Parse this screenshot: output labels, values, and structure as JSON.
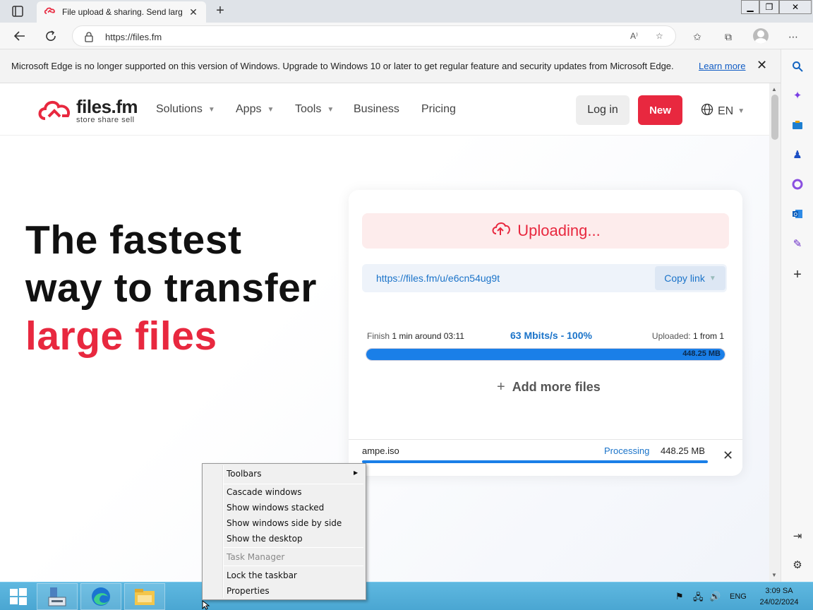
{
  "browser": {
    "tab_title": "File upload & sharing. Send large files",
    "url": "https://files.fm",
    "infobar": {
      "message": "Microsoft Edge is no longer supported on this version of Windows. Upgrade to Windows 10 or later to get regular feature and security updates from Microsoft Edge.",
      "link": "Learn more"
    }
  },
  "site": {
    "logo_name": "files.fm",
    "logo_tagline": "store share sell",
    "nav": [
      {
        "label": "Solutions"
      },
      {
        "label": "Apps"
      },
      {
        "label": "Tools"
      },
      {
        "label": "Business"
      },
      {
        "label": "Pricing"
      }
    ],
    "login_label": "Log in",
    "new_label": "New",
    "language": "EN"
  },
  "hero": {
    "line1": "The fastest",
    "line2": "way to transfer",
    "line3": "large files"
  },
  "upload": {
    "status": "Uploading...",
    "share_link": "https://files.fm/u/e6cn54ug9t",
    "copy_label": "Copy link",
    "finish_label": "Finish",
    "finish_value": "1 min around 03:11",
    "speed": "63 Mbits/s - 100%",
    "uploaded_label": "Uploaded:",
    "uploaded_value": "1 from 1",
    "progress_percent": 100,
    "total_size": "448.25 MB",
    "add_more_label": "Add more files",
    "file": {
      "name": "ampe.iso",
      "state": "Processing",
      "size": "448.25 MB"
    }
  },
  "context_menu": {
    "items": [
      {
        "label": "Toolbars"
      },
      {
        "label": "Cascade windows"
      },
      {
        "label": "Show windows stacked"
      },
      {
        "label": "Show windows side by side"
      },
      {
        "label": "Show the desktop"
      },
      {
        "label": "Task Manager"
      },
      {
        "label": "Lock the taskbar"
      },
      {
        "label": "Properties"
      }
    ]
  },
  "taskbar": {
    "language": "ENG",
    "time": "3:09 SA",
    "date": "24/02/2024"
  },
  "colors": {
    "brand_red": "#e8283f",
    "link_blue": "#1a73c9",
    "taskbar": "#4aa6d2"
  }
}
